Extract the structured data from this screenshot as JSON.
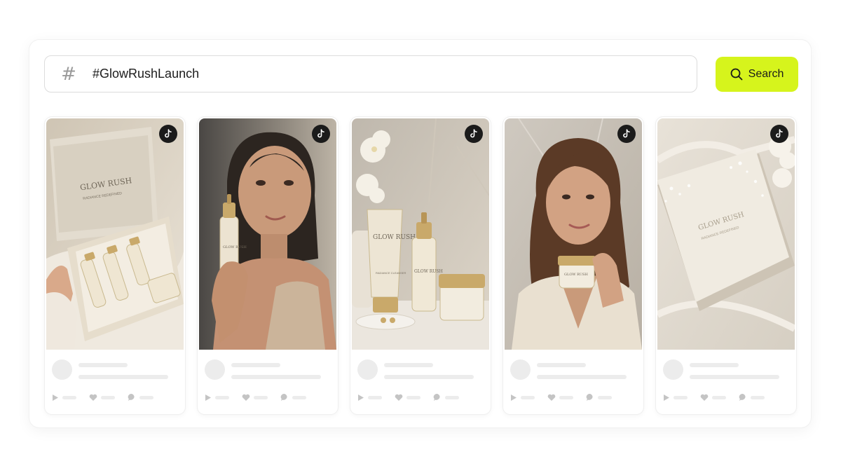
{
  "search": {
    "hash_symbol": "#",
    "query": "#GlowRushLaunch",
    "button_label": "Search"
  },
  "cards": [
    {
      "kind": "boxed-set",
      "brand_text": "GLOW RUSH",
      "tagline": "RADIANCE REDEFINED"
    },
    {
      "kind": "model-serum",
      "brand_text": "GLOW RUSH"
    },
    {
      "kind": "product-lineup",
      "brand_text": "GLOW RUSH",
      "tagline": "RADIANCE CLEANSER"
    },
    {
      "kind": "model-cream",
      "brand_text": "GLOW RUSH"
    },
    {
      "kind": "sealed-box",
      "brand_text": "GLOW RUSH",
      "tagline": "RADIANCE REDEFINED"
    }
  ],
  "colors": {
    "accent": "#d6f41c",
    "skeleton": "#ececec",
    "tiktok_badge": "#1b1b1b"
  },
  "icons": [
    "hash-icon",
    "search-icon",
    "tiktok-icon",
    "play-icon",
    "heart-icon",
    "comment-icon"
  ]
}
